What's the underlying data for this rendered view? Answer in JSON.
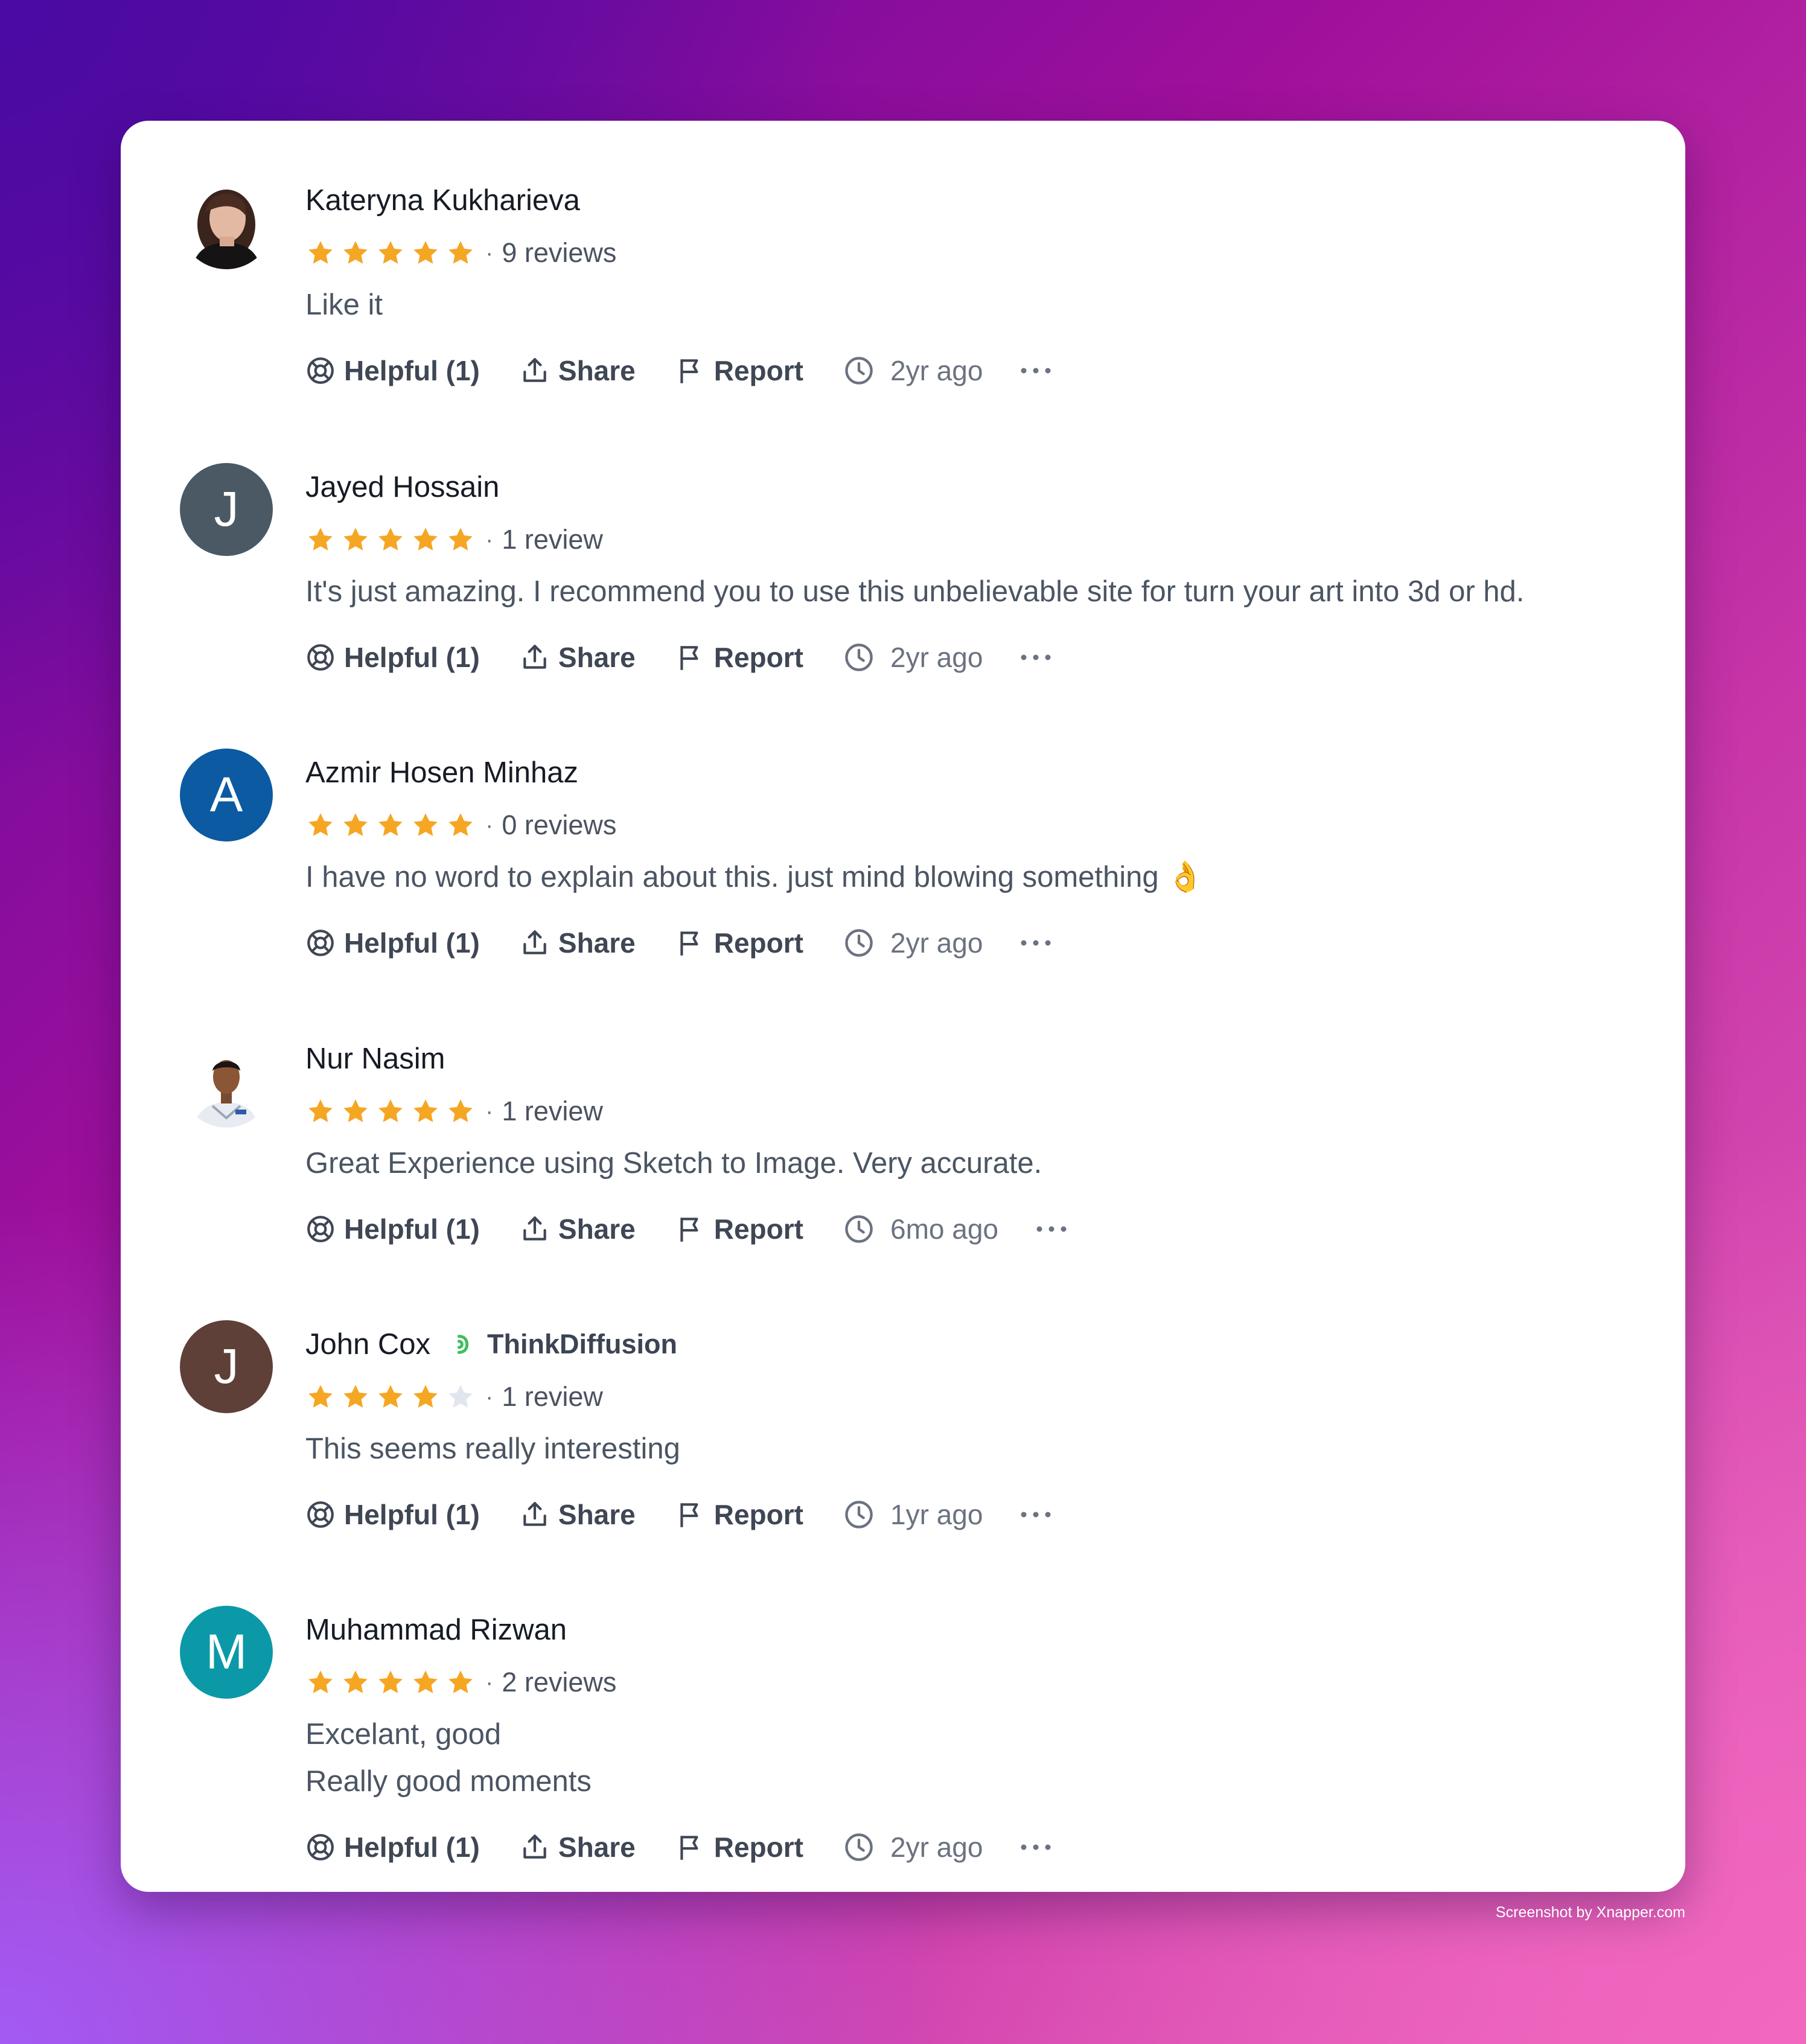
{
  "reviews": [
    {
      "name": "Kateryna Kukharieva",
      "avatar_initial": "",
      "avatar_kind": "photo-woman",
      "badge": "",
      "rating": 5,
      "review_count": "9 reviews",
      "text": [
        "Like it"
      ],
      "helpful": "Helpful (1)",
      "share": "Share",
      "report": "Report",
      "time": "2yr ago"
    },
    {
      "name": "Jayed Hossain",
      "avatar_initial": "J",
      "avatar_color": "#4a5963",
      "badge": "",
      "rating": 5,
      "review_count": "1 review",
      "text": [
        "It's just amazing. I recommend you to use this unbelievable site for turn your art into 3d or hd."
      ],
      "helpful": "Helpful (1)",
      "share": "Share",
      "report": "Report",
      "time": "2yr ago"
    },
    {
      "name": "Azmir Hosen Minhaz",
      "avatar_initial": "A",
      "avatar_color": "#0b5aa2",
      "badge": "",
      "rating": 5,
      "review_count": "0 reviews",
      "text": [
        "I have no word to explain about this. just mind blowing something 👌"
      ],
      "helpful": "Helpful (1)",
      "share": "Share",
      "report": "Report",
      "time": "2yr ago"
    },
    {
      "name": "Nur Nasim",
      "avatar_initial": "",
      "avatar_kind": "photo-man",
      "badge": "",
      "rating": 5,
      "review_count": "1 review",
      "text": [
        "Great Experience using Sketch to Image. Very accurate."
      ],
      "helpful": "Helpful (1)",
      "share": "Share",
      "report": "Report",
      "time": "6mo ago"
    },
    {
      "name": "John Cox",
      "avatar_initial": "J",
      "avatar_color": "#5e4038",
      "badge": "ThinkDiffusion",
      "rating": 4,
      "review_count": "1 review",
      "text": [
        "This seems really interesting"
      ],
      "helpful": "Helpful (1)",
      "share": "Share",
      "report": "Report",
      "time": "1yr ago"
    },
    {
      "name": "Muhammad Rizwan",
      "avatar_initial": "M",
      "avatar_color": "#0b99a8",
      "badge": "",
      "rating": 5,
      "review_count": "2 reviews",
      "text": [
        "Excelant, good",
        "Really good moments"
      ],
      "helpful": "Helpful (1)",
      "share": "Share",
      "report": "Report",
      "time": "2yr ago"
    }
  ],
  "colors": {
    "star": "#f5a623",
    "star_empty": "#e1e5ee",
    "badge_accent": "#3fbf5f"
  },
  "watermark": "Screenshot by Xnapper.com"
}
